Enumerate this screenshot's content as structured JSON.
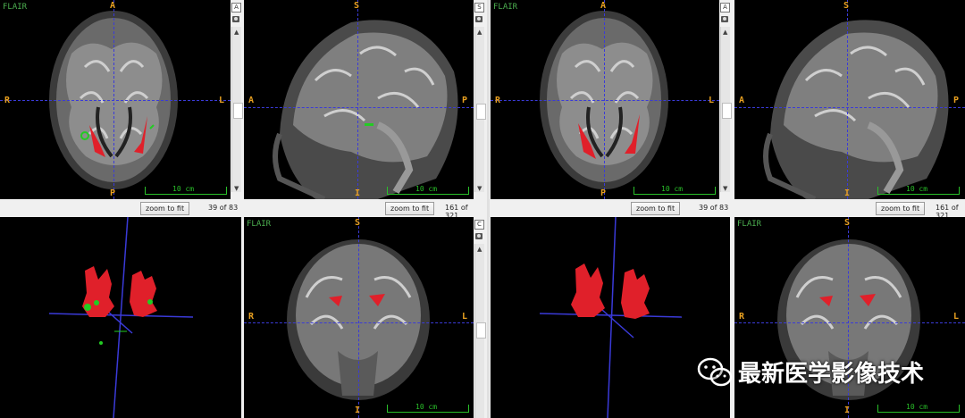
{
  "sequence_label": "FLAIR",
  "directions": {
    "anterior": "A",
    "posterior": "P",
    "right": "R",
    "left": "L",
    "superior": "S",
    "inferior": "I"
  },
  "scale_label": "10 cm",
  "zoom_button_label": "zoom to fit",
  "side_buttons": {
    "axial": "A",
    "sagittal": "S",
    "coronal": "C"
  },
  "left_panel": {
    "axial_count": "39 of 83",
    "sagittal_count": "161 of 321"
  },
  "right_panel": {
    "axial_count": "39 of 83",
    "sagittal_count": "161 of 321"
  },
  "watermark": {
    "text": "最新医学影像技术",
    "icon": "wechat-icon"
  },
  "colors": {
    "crosshair": "#3a3ad8",
    "lesion": "#e0202a",
    "seed": "#22cc22",
    "label_orange": "#e8a020",
    "label_green": "#4caf50",
    "scale_green": "#29c029"
  }
}
